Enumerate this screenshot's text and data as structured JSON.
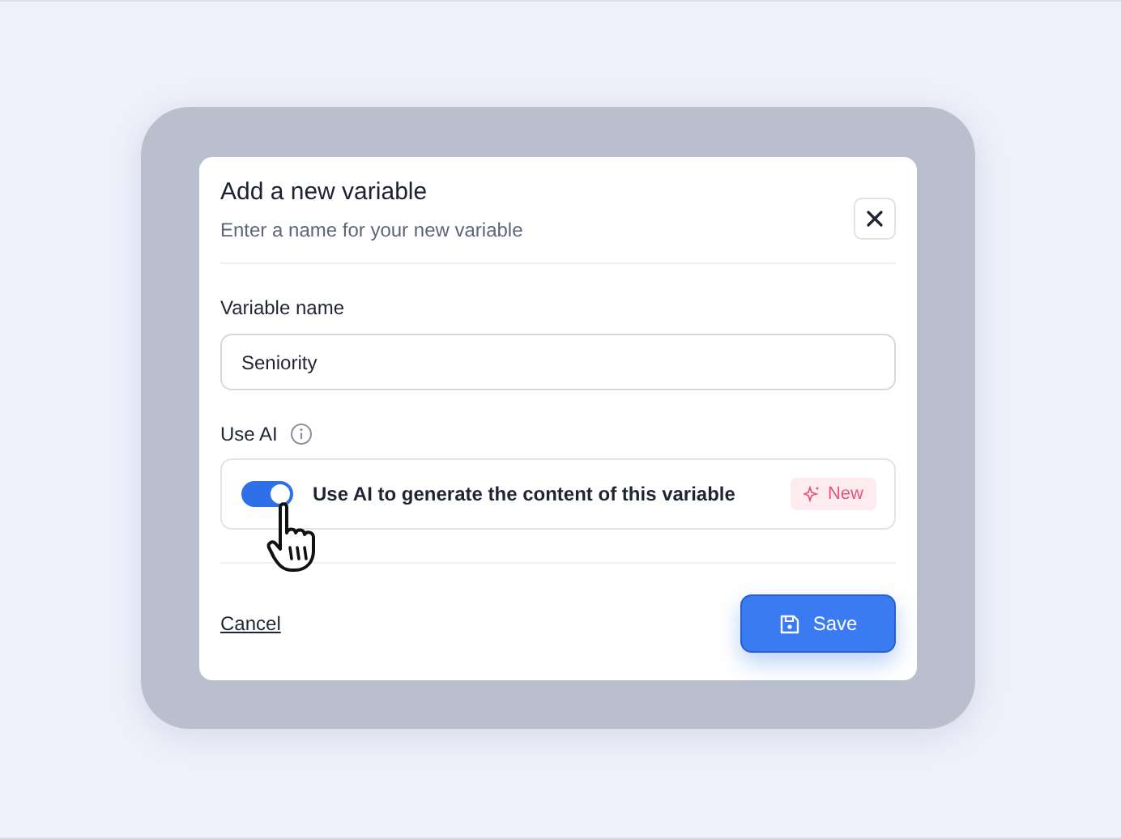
{
  "dialog": {
    "title": "Add a new variable",
    "subtitle": "Enter a name for your new variable",
    "name_field": {
      "label": "Variable name",
      "value": "Seniority"
    },
    "ai_section": {
      "label": "Use AI",
      "toggle": {
        "on": true,
        "text": "Use AI to generate the content of this variable"
      },
      "badge": "New"
    },
    "actions": {
      "cancel": "Cancel",
      "save": "Save"
    }
  }
}
